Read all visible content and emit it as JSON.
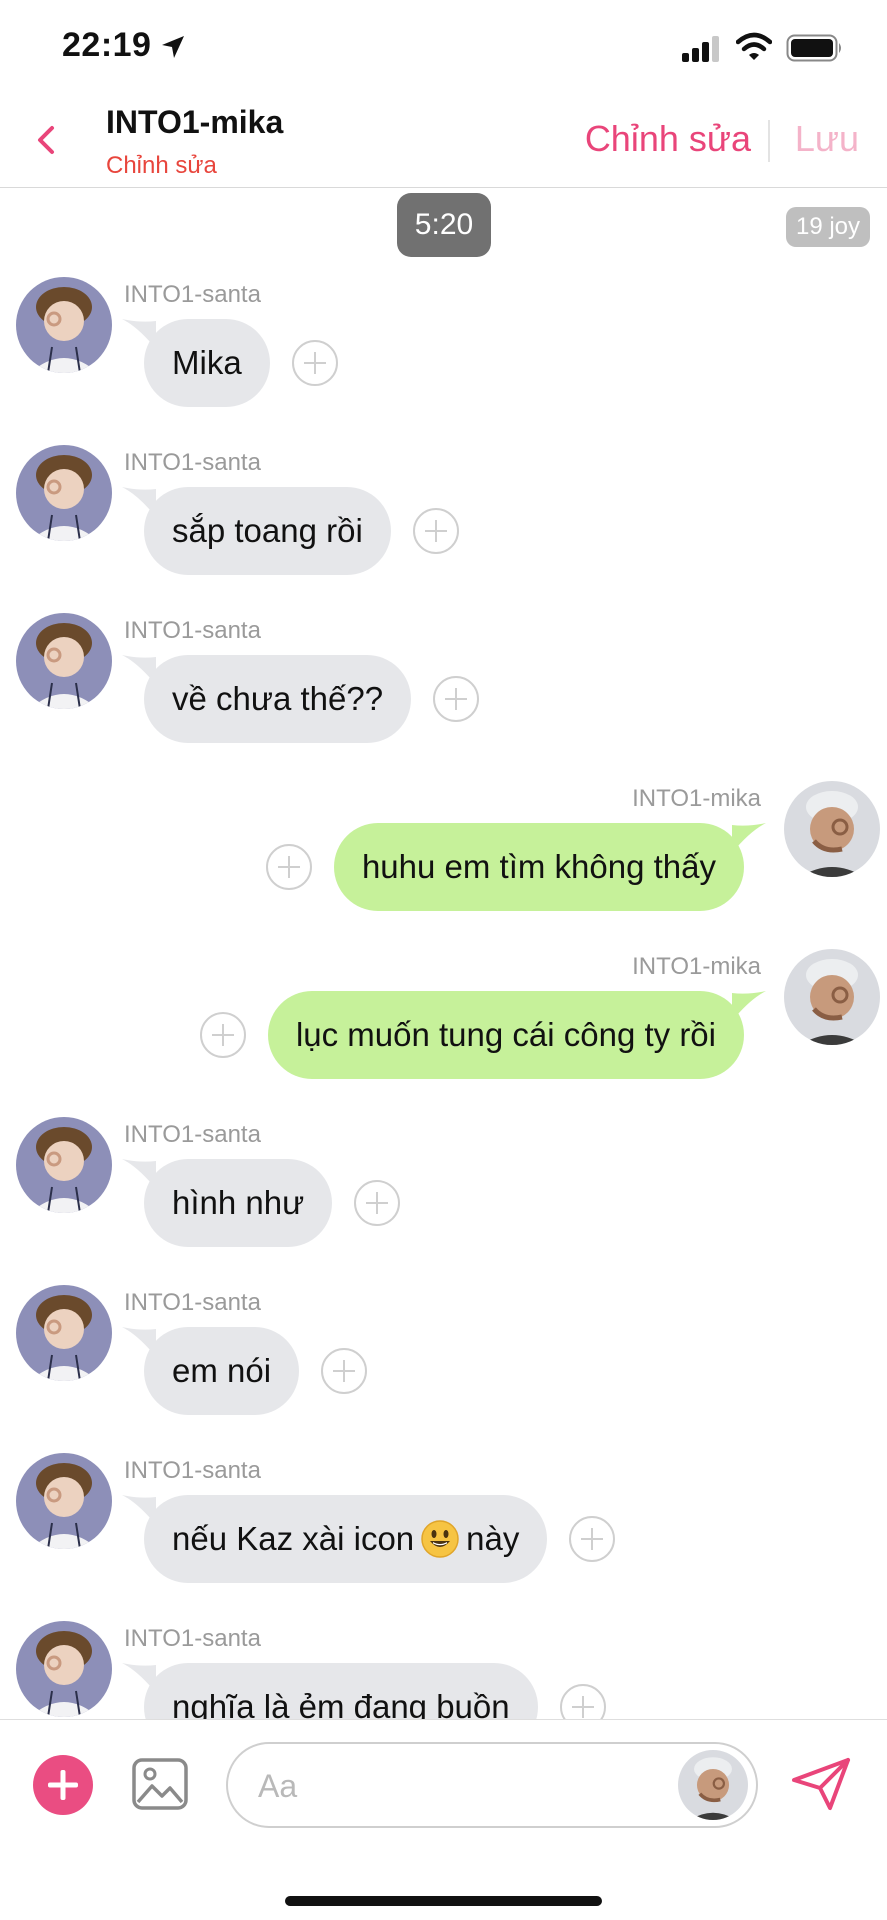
{
  "status_bar": {
    "time": "22:19",
    "icons": [
      "location-arrow-icon",
      "cellular-signal-icon",
      "wifi-icon",
      "battery-icon"
    ]
  },
  "header": {
    "back_icon": "chevron-left-icon",
    "title": "INTO1-mika",
    "subtitle": "Chỉnh sửa",
    "edit_label": "Chỉnh sửa",
    "save_label": "Lưu"
  },
  "chat": {
    "time_label": "5:20",
    "joy_label": "19 joy",
    "messages": [
      {
        "side": "in",
        "sender": "INTO1-santa",
        "text": "Mika"
      },
      {
        "side": "in",
        "sender": "INTO1-santa",
        "text": "sắp toang rồi"
      },
      {
        "side": "in",
        "sender": "INTO1-santa",
        "text": "về chưa thế??"
      },
      {
        "side": "out",
        "sender": "INTO1-mika",
        "text": "huhu em tìm không thấy"
      },
      {
        "side": "out",
        "sender": "INTO1-mika",
        "text": "lục muốn tung cái công ty rồi"
      },
      {
        "side": "in",
        "sender": "INTO1-santa",
        "text": "hình như"
      },
      {
        "side": "in",
        "sender": "INTO1-santa",
        "text": "em nói"
      },
      {
        "side": "in",
        "sender": "INTO1-santa",
        "text_before": "nếu Kaz xài icon",
        "emoji": "smiley-emoji",
        "text_after": "này"
      },
      {
        "side": "in",
        "sender": "INTO1-santa",
        "text": "nghĩa là ẻm đang buồn"
      }
    ]
  },
  "composer": {
    "placeholder": "Aa",
    "icons": [
      "plus-icon",
      "image-icon",
      "send-icon"
    ]
  },
  "colors": {
    "accent_pink": "#e9457a",
    "accent_pink_light": "#f4b3c9",
    "subtitle_red": "#e8453c",
    "incoming_bubble": "#e6e7ea",
    "outgoing_bubble": "#c6f19a",
    "time_pill": "#717171"
  }
}
